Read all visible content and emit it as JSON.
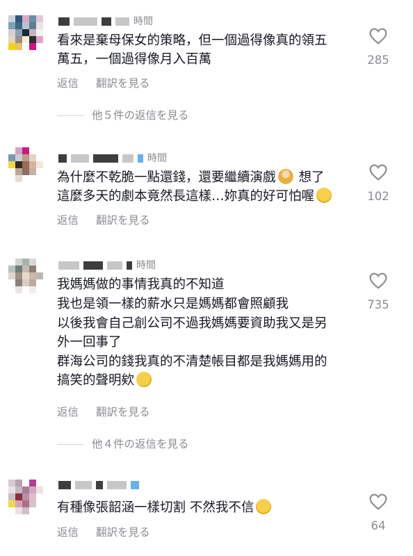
{
  "comments": [
    {
      "time": "時間",
      "lines": [
        "看來是棄母保女的策略，但一個過得像真的領五",
        "萬五，一個過得像月入百萬"
      ],
      "reply_label": "返信",
      "translate_label": "翻訳を見る",
      "likes": "285",
      "view_replies": "他５件の返信を見る"
    },
    {
      "time": "時間",
      "lines": [
        "為什麼不乾脆一點還錢，還要繼續演戲",
        "這麼多天的劇本竟然長這樣…妳真的好可怕喔"
      ],
      "line1_suffix": "想了",
      "reply_label": "返信",
      "translate_label": "翻訳を見る",
      "likes": "102",
      "emojis": [
        "person-tipping-hand-emoji",
        "sad-sweat-face-emoji"
      ]
    },
    {
      "time": "時間",
      "lines": [
        "我媽媽做的事情我真的不知道",
        "我也是領一樣的薪水只是媽媽都會照顧我",
        "以後我會自己創公司不過我媽媽要資助我又是另",
        "外一回事了",
        "群海公司的錢我真的不清楚帳目都是我媽媽用的",
        "搞笑的聲明欸"
      ],
      "reply_label": "返信",
      "translate_label": "翻訳を見る",
      "likes": "735",
      "view_replies": "他４件の返信を見る",
      "emojis": [
        "rolling-laughing-face-emoji"
      ]
    },
    {
      "lines": [
        "有種像張韶涵一樣切割 不然我不信"
      ],
      "reply_label": "返信",
      "translate_label": "翻訳を見る",
      "likes": "64",
      "emojis": [
        "steam-nose-face-emoji"
      ]
    }
  ],
  "colors": {
    "text": "#161823",
    "secondary": "#8a8b91",
    "emoji_yellow": "#f5c33b"
  }
}
